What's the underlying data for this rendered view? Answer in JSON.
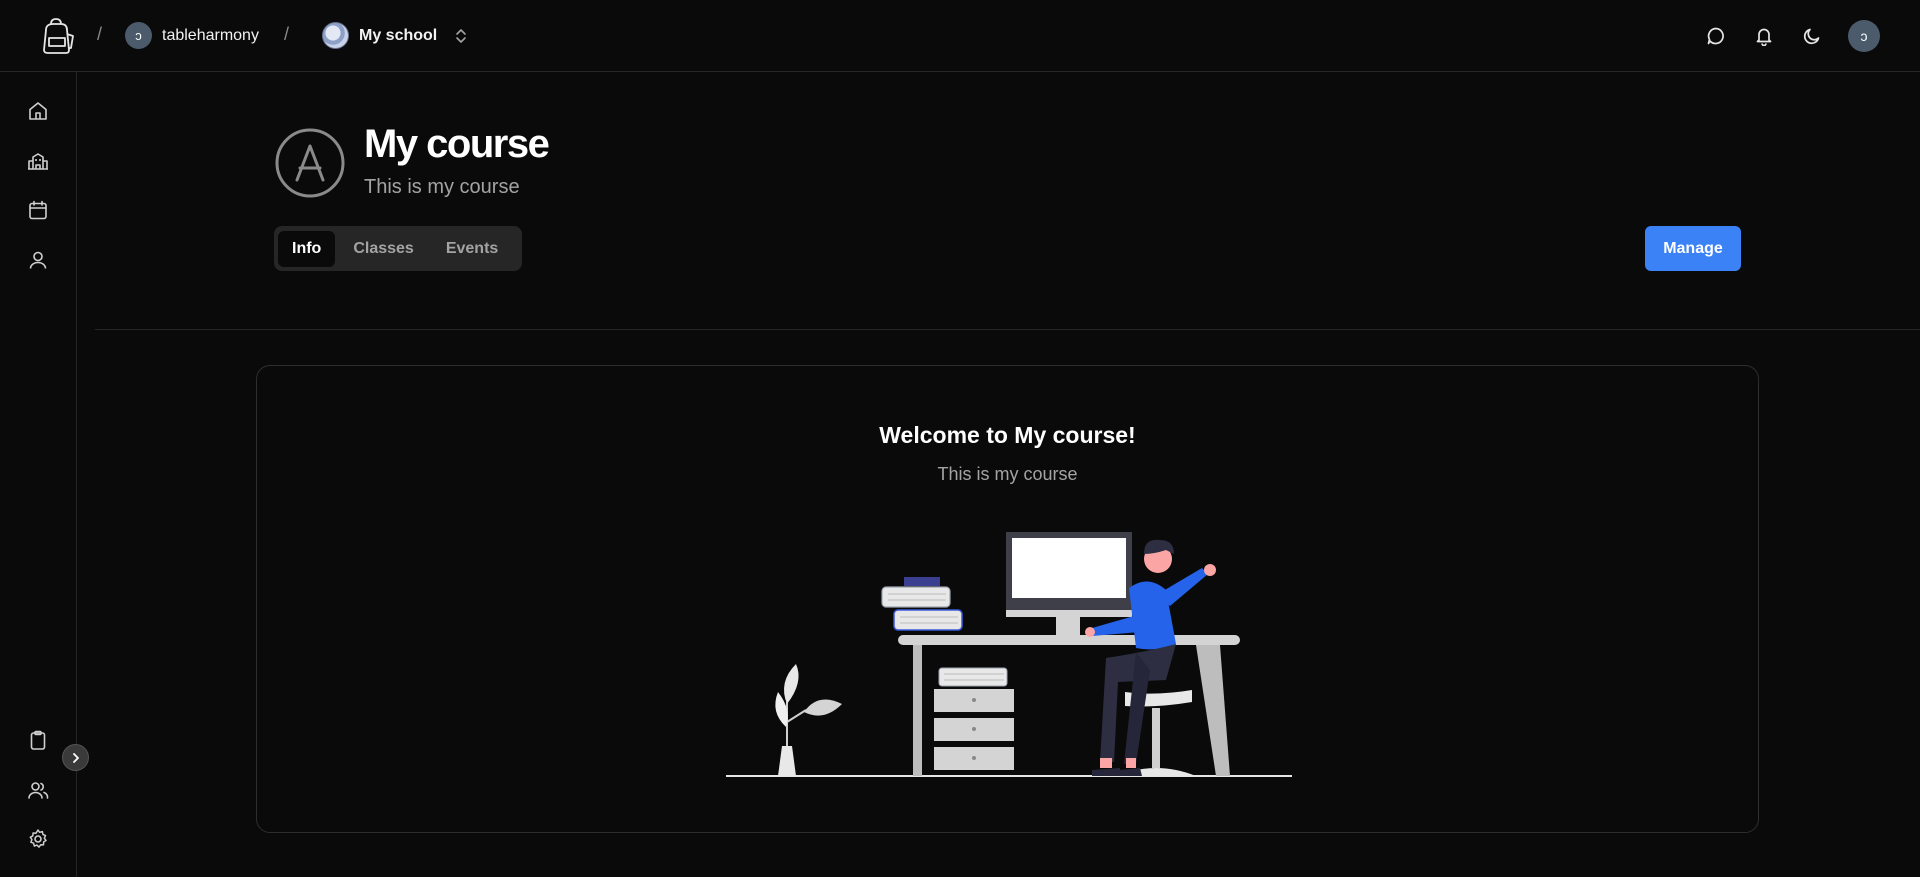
{
  "topbar": {
    "user_crumb": "tableharmony",
    "user_initial": "ɔ",
    "school_crumb": "My school",
    "separator": "/"
  },
  "header": {
    "title": "My course",
    "subtitle": "This is my course"
  },
  "tabs": [
    {
      "label": "Info",
      "active": true
    },
    {
      "label": "Classes",
      "active": false
    },
    {
      "label": "Events",
      "active": false
    }
  ],
  "actions": {
    "manage_label": "Manage"
  },
  "card": {
    "welcome": "Welcome to My course!",
    "description": "This is my course"
  },
  "sidebar": {
    "top_items": [
      "home-icon",
      "school-icon",
      "calendar-icon",
      "user-icon"
    ],
    "bottom_items": [
      "clipboard-icon",
      "users-icon",
      "settings-icon"
    ]
  },
  "colors": {
    "background": "#0a0a0a",
    "accent": "#3b82f6",
    "border": "#262626"
  }
}
